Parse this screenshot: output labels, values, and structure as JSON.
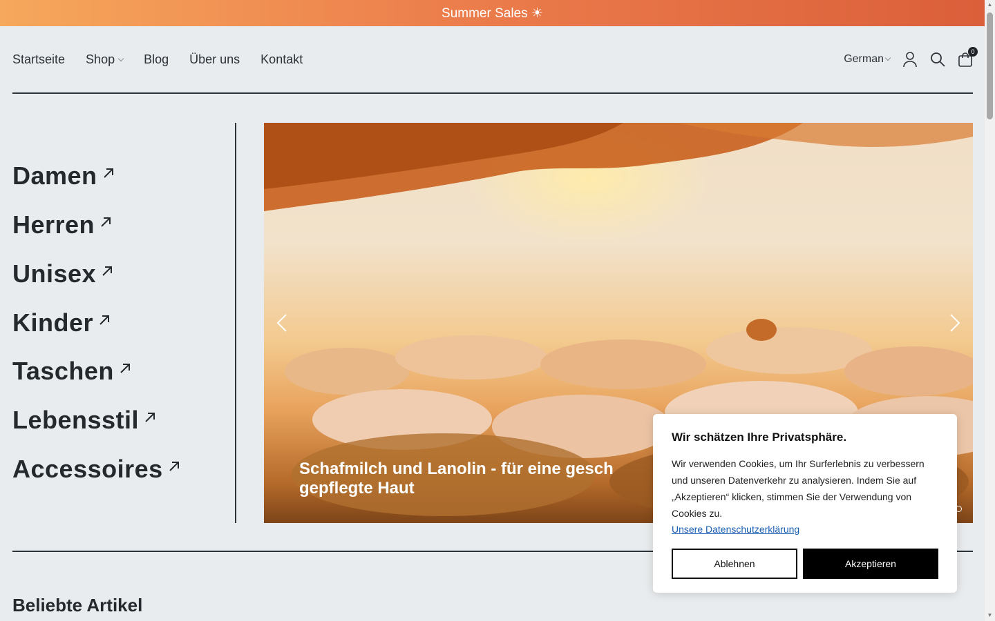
{
  "announcement": "Summer Sales ☀",
  "nav": {
    "links": [
      {
        "label": "Startseite",
        "dropdown": false
      },
      {
        "label": "Shop",
        "dropdown": true
      },
      {
        "label": "Blog",
        "dropdown": false
      },
      {
        "label": "Über uns",
        "dropdown": false
      },
      {
        "label": "Kontakt",
        "dropdown": false
      }
    ],
    "language": "German",
    "cart_count": "0",
    "icons": [
      "account-icon",
      "search-icon",
      "cart-icon"
    ]
  },
  "categories": [
    "Damen",
    "Herren",
    "Unisex",
    "Kinder",
    "Taschen",
    "Lebensstil",
    "Accessoires"
  ],
  "hero": {
    "title": "Schafmilch und Lanolin - für eine gesch",
    "title_line2": "gepflegte Haut",
    "slides": 2,
    "active_slide": 1
  },
  "section_title": "Beliebte Artikel",
  "cookie": {
    "title": "Wir schätzen Ihre Privatsphäre.",
    "text": "Wir verwenden Cookies, um Ihr Surferlebnis zu verbessern und unseren Datenverkehr zu analysieren. Indem Sie auf „Akzeptieren“ klicken, stimmen Sie der Verwendung von Cookies zu.",
    "link": "Unsere Datenschutzerklärung",
    "decline": "Ablehnen",
    "accept": "Akzeptieren"
  },
  "colors": {
    "announce_start": "#f6a85c",
    "announce_end": "#db5f3a",
    "background": "#e9ecee",
    "text": "#24292e",
    "link": "#1a5fb4"
  }
}
